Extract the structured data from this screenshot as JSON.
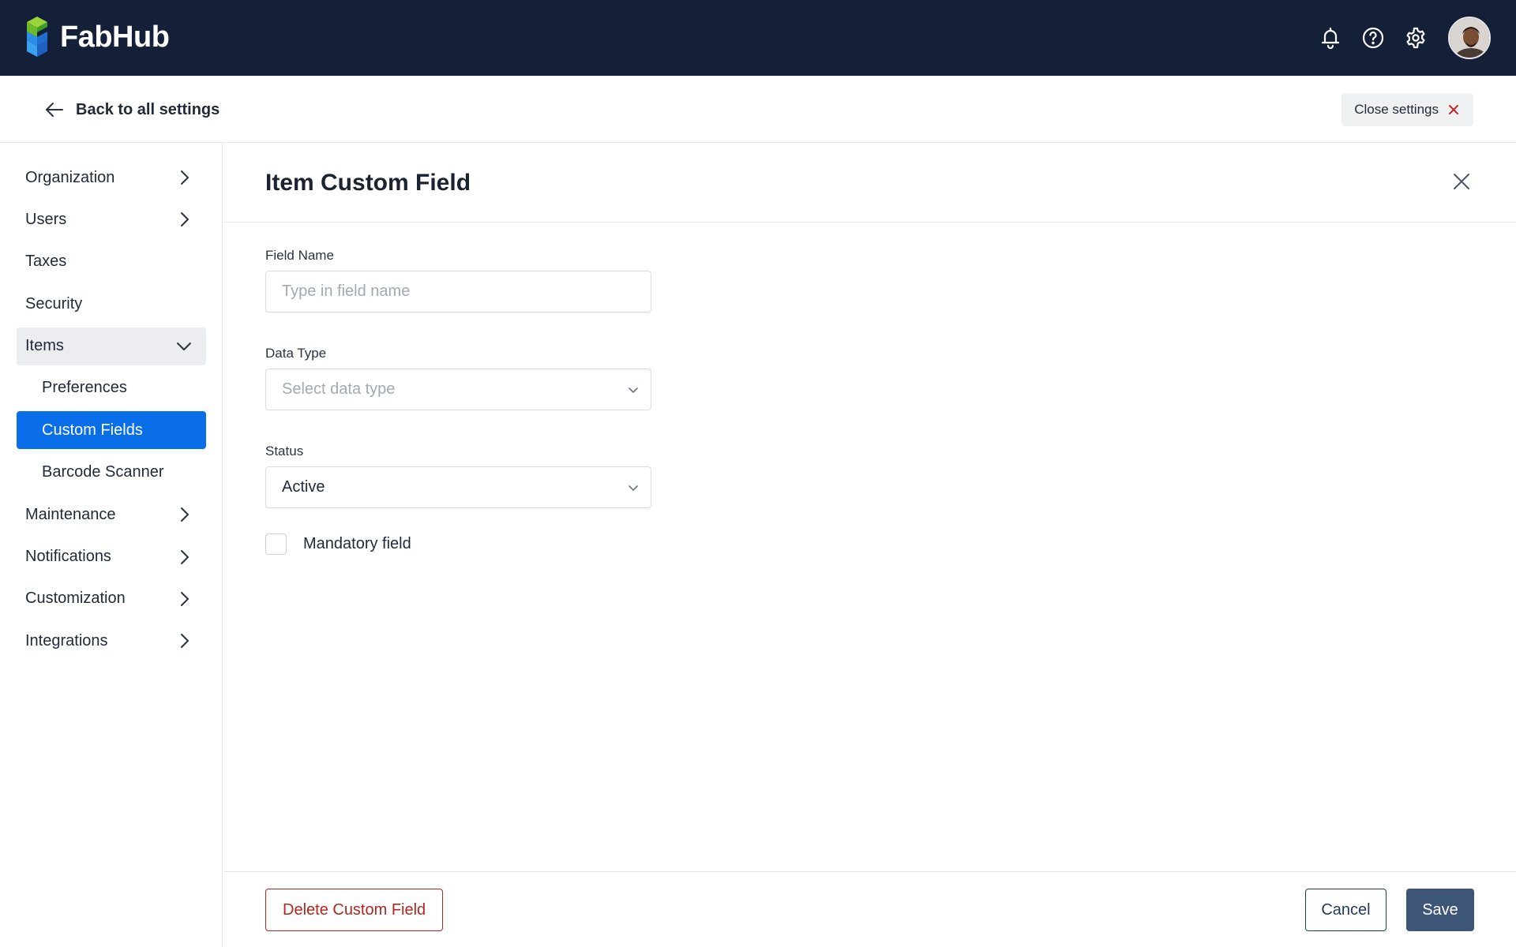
{
  "app": {
    "name": "FabHub",
    "colors": {
      "topbar": "#141f38",
      "accent": "#0a6ee8",
      "danger": "#b3261e",
      "save": "#3d5577"
    }
  },
  "topbar": {
    "icons": [
      "bell-icon",
      "help-icon",
      "gear-icon"
    ],
    "avatar": "user-avatar"
  },
  "subbar": {
    "back_label": "Back to all settings",
    "close_label": "Close settings"
  },
  "sidebar": {
    "items": [
      {
        "label": "Organization",
        "chevron": "right"
      },
      {
        "label": "Users",
        "chevron": "right"
      },
      {
        "label": "Taxes"
      },
      {
        "label": "Security"
      },
      {
        "label": "Items",
        "chevron": "down",
        "expanded": true
      },
      {
        "label": "Preferences",
        "sub": true
      },
      {
        "label": "Custom Fields",
        "sub": true,
        "active": true
      },
      {
        "label": "Barcode Scanner",
        "sub": true
      },
      {
        "label": "Maintenance",
        "chevron": "right"
      },
      {
        "label": "Notifications",
        "chevron": "right"
      },
      {
        "label": "Customization",
        "chevron": "right"
      },
      {
        "label": "Integrations",
        "chevron": "right"
      }
    ]
  },
  "main": {
    "title": "Item Custom Field",
    "form": {
      "field_name": {
        "label": "Field Name",
        "value": "",
        "placeholder": "Type in field name"
      },
      "data_type": {
        "label": "Data Type",
        "value": "",
        "placeholder": "Select data type"
      },
      "status": {
        "label": "Status",
        "value": "Active"
      },
      "mandatory": {
        "label": "Mandatory field",
        "checked": false
      }
    },
    "footer": {
      "delete_label": "Delete Custom Field",
      "cancel_label": "Cancel",
      "save_label": "Save"
    }
  }
}
